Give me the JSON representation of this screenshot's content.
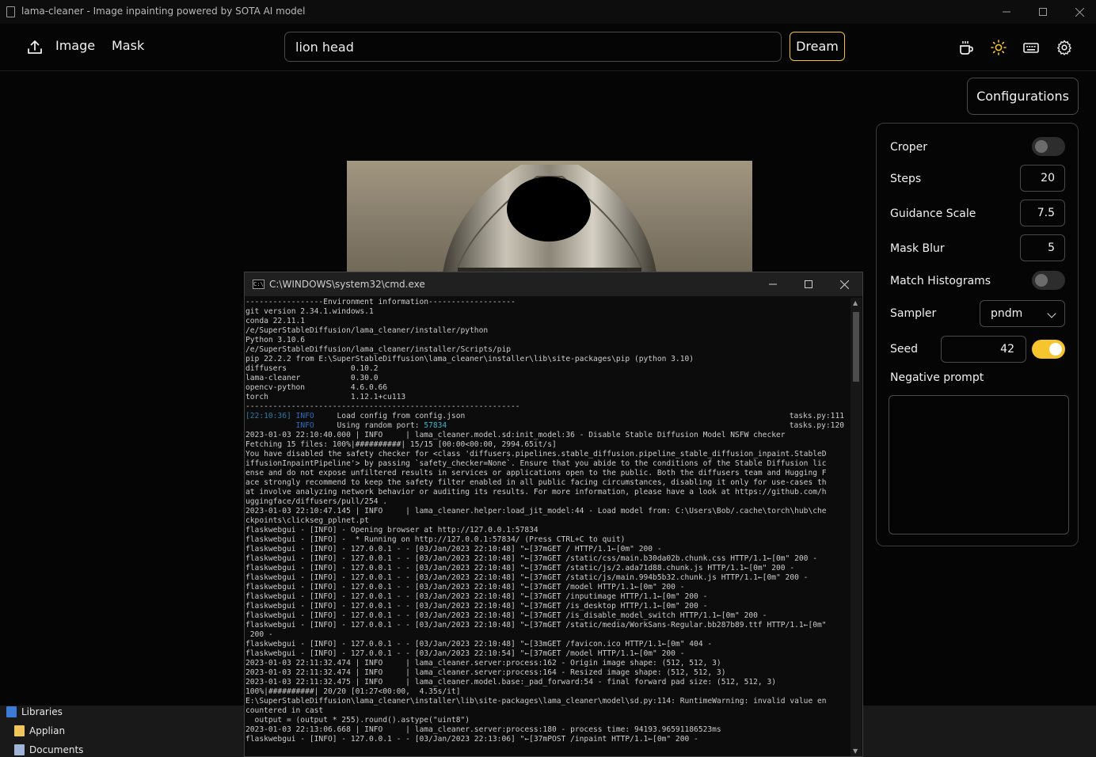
{
  "window": {
    "title": "lama-cleaner - Image inpainting powered by SOTA AI model",
    "minimize": "—",
    "maximize": "☐",
    "close": "✕"
  },
  "toolbar": {
    "image_label": "Image",
    "mask_label": "Mask",
    "prompt_value": "lion head",
    "dream_label": "Dream"
  },
  "config_button": "Configurations",
  "panel": {
    "croper_label": "Croper",
    "croper_on": false,
    "steps_label": "Steps",
    "steps_value": "20",
    "guidance_label": "Guidance Scale",
    "guidance_value": "7.5",
    "mask_blur_label": "Mask Blur",
    "mask_blur_value": "5",
    "match_hist_label": "Match Histograms",
    "match_hist_on": false,
    "sampler_label": "Sampler",
    "sampler_value": "pndm",
    "seed_label": "Seed",
    "seed_value": "42",
    "seed_fixed_on": true,
    "negative_prompt_label": "Negative prompt",
    "negative_prompt_value": ""
  },
  "explorer": {
    "items": [
      "Libraries",
      "Applian",
      "Documents"
    ]
  },
  "cmd": {
    "title": "C:\\WINDOWS\\system32\\cmd.exe",
    "lines": [
      "-----------------Environment information-------------------",
      "git version 2.34.1.windows.1",
      "conda 22.11.1",
      "/e/SuperStableDiffusion/lama_cleaner/installer/python",
      "Python 3.10.6",
      "/e/SuperStableDiffusion/lama_cleaner/installer/Scripts/pip",
      "pip 22.2.2 from E:\\SuperStableDiffusion\\lama_cleaner\\installer\\lib\\site-packages\\pip (python 3.10)",
      "diffusers              0.10.2",
      "lama-cleaner           0.30.0",
      "opencv-python          4.6.0.66",
      "torch                  1.12.1+cu113",
      "------------------------------------------------------------"
    ],
    "log_lines": [
      {
        "time": "[22:10:36]",
        "level": "INFO",
        "msg": "Load config from config.json",
        "src": "tasks.py:111"
      },
      {
        "time": "",
        "level": "INFO",
        "msg": "Using random port: ",
        "port": "57834",
        "src": "tasks.py:120"
      }
    ],
    "tail_lines": [
      "2023-01-03 22:10:40.000 | INFO     | lama_cleaner.model.sd:init_model:36 - Disable Stable Diffusion Model NSFW checker",
      "Fetching 15 files: 100%|##########| 15/15 [00:00<00:00, 2994.65it/s]",
      "You have disabled the safety checker for <class 'diffusers.pipelines.stable_diffusion.pipeline_stable_diffusion_inpaint.StableD",
      "iffusionInpaintPipeline'> by passing `safety_checker=None`. Ensure that you abide to the conditions of the Stable Diffusion lic",
      "ense and do not expose unfiltered results in services or applications open to the public. Both the diffusers team and Hugging F",
      "ace strongly recommend to keep the safety filter enabled in all public facing circumstances, disabling it only for use-cases th",
      "at involve analyzing network behavior or auditing its results. For more information, please have a look at https://github.com/h",
      "uggingface/diffusers/pull/254 .",
      "2023-01-03 22:10:47.145 | INFO     | lama_cleaner.helper:load_jit_model:44 - Load model from: C:\\Users\\Bob/.cache\\torch\\hub\\che",
      "ckpoints\\clickseg_pplnet.pt",
      "flaskwebgui - [INFO] - Opening browser at http://127.0.0.1:57834",
      "flaskwebgui - [INFO] -  * Running on http://127.0.0.1:57834/ (Press CTRL+C to quit)",
      "flaskwebgui - [INFO] - 127.0.0.1 - - [03/Jan/2023 22:10:48] \"←[37mGET / HTTP/1.1←[0m\" 200 -",
      "flaskwebgui - [INFO] - 127.0.0.1 - - [03/Jan/2023 22:10:48] \"←[37mGET /static/css/main.b30da02b.chunk.css HTTP/1.1←[0m\" 200 -",
      "flaskwebgui - [INFO] - 127.0.0.1 - - [03/Jan/2023 22:10:48] \"←[37mGET /static/js/2.ada71d88.chunk.js HTTP/1.1←[0m\" 200 -",
      "flaskwebgui - [INFO] - 127.0.0.1 - - [03/Jan/2023 22:10:48] \"←[37mGET /static/js/main.994b5b32.chunk.js HTTP/1.1←[0m\" 200 -",
      "flaskwebgui - [INFO] - 127.0.0.1 - - [03/Jan/2023 22:10:48] \"←[37mGET /model HTTP/1.1←[0m\" 200 -",
      "flaskwebgui - [INFO] - 127.0.0.1 - - [03/Jan/2023 22:10:48] \"←[37mGET /inputimage HTTP/1.1←[0m\" 200 -",
      "flaskwebgui - [INFO] - 127.0.0.1 - - [03/Jan/2023 22:10:48] \"←[37mGET /is_desktop HTTP/1.1←[0m\" 200 -",
      "flaskwebgui - [INFO] - 127.0.0.1 - - [03/Jan/2023 22:10:48] \"←[37mGET /is_disable_model_switch HTTP/1.1←[0m\" 200 -",
      "flaskwebgui - [INFO] - 127.0.0.1 - - [03/Jan/2023 22:10:48] \"←[37mGET /static/media/WorkSans-Regular.bb287b89.ttf HTTP/1.1←[0m\"",
      " 200 -",
      "flaskwebgui - [INFO] - 127.0.0.1 - - [03/Jan/2023 22:10:48] \"←[33mGET /favicon.ico HTTP/1.1←[0m\" 404 -",
      "flaskwebgui - [INFO] - 127.0.0.1 - - [03/Jan/2023 22:10:54] \"←[37mGET /model HTTP/1.1←[0m\" 200 -",
      "2023-01-03 22:11:32.474 | INFO     | lama_cleaner.server:process:162 - Origin image shape: (512, 512, 3)",
      "2023-01-03 22:11:32.474 | INFO     | lama_cleaner.server:process:164 - Resized image shape: (512, 512, 3)",
      "2023-01-03 22:11:32.475 | INFO     | lama_cleaner.model.base:_pad_forward:54 - final forward pad size: (512, 512, 3)",
      "100%|##########| 20/20 [01:27<00:00,  4.35s/it]",
      "E:\\SuperStableDiffusion\\lama_cleaner\\installer\\lib\\site-packages\\lama_cleaner\\model\\sd.py:114: RuntimeWarning: invalid value en",
      "countered in cast",
      "  output = (output * 255).round().astype(\"uint8\")",
      "2023-01-03 22:13:06.668 | INFO     | lama_cleaner.server:process:180 - process time: 94193.96591186523ms",
      "flaskwebgui - [INFO] - 127.0.0.1 - - [03/Jan/2023 22:13:06] \"←[37mPOST /inpaint HTTP/1.1←[0m\" 200 -"
    ]
  },
  "colors": {
    "accent": "#f6c42c",
    "background": "#050505",
    "border": "#4a4a4a"
  }
}
